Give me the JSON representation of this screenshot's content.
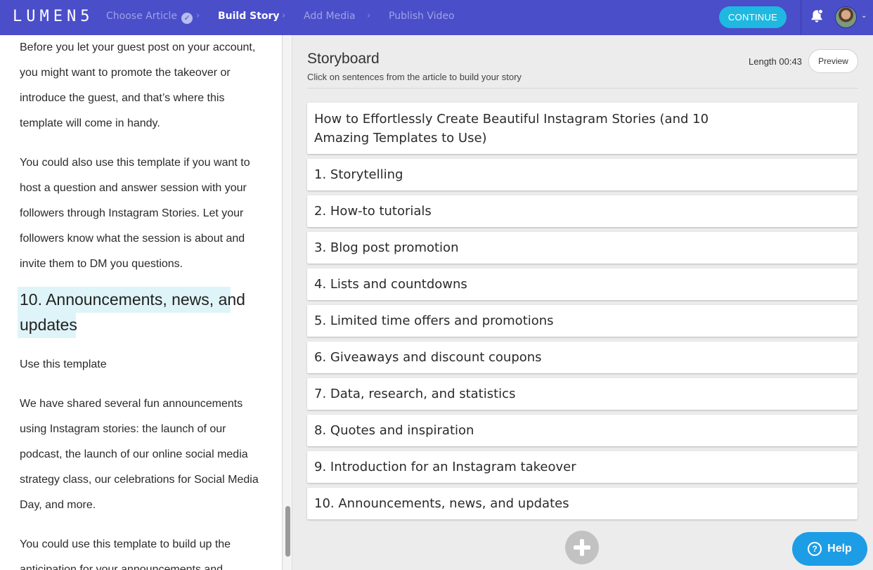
{
  "header": {
    "logo": "LUMEN5",
    "steps": [
      {
        "label": "Choose Article",
        "state": "done"
      },
      {
        "label": "Build Story",
        "state": "active"
      },
      {
        "label": "Add Media",
        "state": "upcoming"
      },
      {
        "label": "Publish Video",
        "state": "upcoming"
      }
    ],
    "check_glyph": "✓",
    "chevron_glyph": "›",
    "continue_label": "CONTINUE",
    "caret_glyph": "⌄",
    "icons": [
      "bell-icon",
      "avatar"
    ]
  },
  "article": {
    "paragraphs": [
      "Before you let your guest post on your account, you might want to promote the takeover or introduce the guest, and that’s where this template will come in handy.",
      "You could also use this template if you want to host a question and answer session with your followers through Instagram Stories.  Let your followers know what the session is about and invite them to DM you questions.",
      "Use this template",
      "We have shared several fun announcements using Instagram stories: the launch of our podcast, the launch of our online social media strategy class, our celebrations for Social Media Day, and more.",
      "You could use this template to build up the anticipation for your announcements and"
    ],
    "heading_line1": "10. Announcements, news, and",
    "heading_line2": "updates"
  },
  "storyboard": {
    "title": "Storyboard",
    "subtitle": "Click on sentences from the article to build your story",
    "length": "Length 00:43",
    "preview_label": "Preview",
    "cards": [
      "How to Effortlessly Create Beautiful Instagram Stories (and 10 Amazing Templates to Use)",
      "1. Storytelling",
      "2. How-to tutorials",
      "3. Blog post promotion",
      "4. Lists and countdowns",
      "5. Limited time offers and promotions",
      "6. Giveaways and discount coupons",
      "7. Data, research, and statistics",
      "8. Quotes and inspiration",
      "9. Introduction for an Instagram takeover",
      "10. Announcements, news, and updates"
    ]
  },
  "help": {
    "label": "Help",
    "icon_glyph": "?"
  },
  "colors": {
    "header_bg": "#4a4ec9",
    "continue_bg": "#1fb8e0",
    "help_bg": "#1d9de6",
    "highlight": "#dff4f8"
  }
}
